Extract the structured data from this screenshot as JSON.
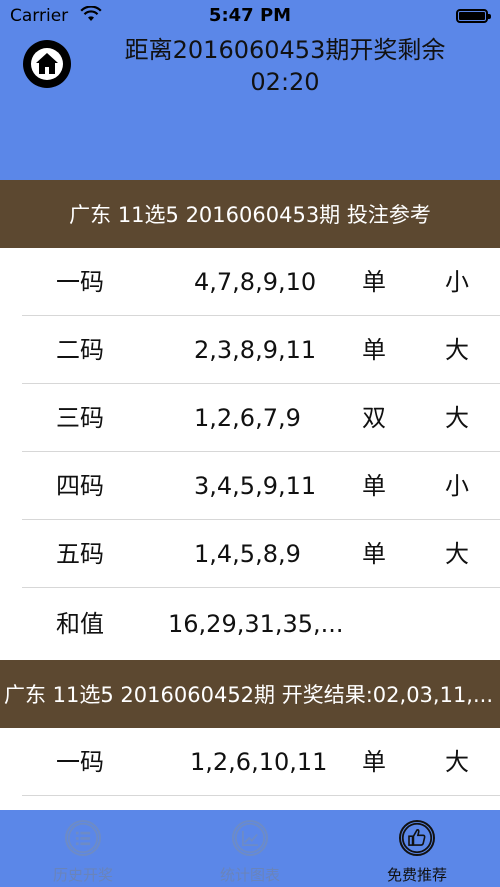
{
  "status_bar": {
    "carrier": "Carrier",
    "time": "5:47 PM"
  },
  "header": {
    "countdown_line1": "距离2016060453期开奖剩余",
    "countdown_line2": "02:20"
  },
  "section1": {
    "title": "广东 11选5 2016060453期 投注参考",
    "rows": [
      {
        "name": "一码",
        "nums": "4,7,8,9,10",
        "odd_even": "单",
        "big_small": "小"
      },
      {
        "name": "二码",
        "nums": "2,3,8,9,11",
        "odd_even": "单",
        "big_small": "大"
      },
      {
        "name": "三码",
        "nums": "1,2,6,7,9",
        "odd_even": "双",
        "big_small": "大"
      },
      {
        "name": "四码",
        "nums": "3,4,5,9,11",
        "odd_even": "单",
        "big_small": "小"
      },
      {
        "name": "五码",
        "nums": "1,4,5,8,9",
        "odd_even": "单",
        "big_small": "大"
      },
      {
        "name": "和值",
        "nums": "16,29,31,35,..."
      }
    ]
  },
  "section2": {
    "title": "广东 11选5 2016060452期 开奖结果:02,03,11,...",
    "rows": [
      {
        "name": "一码",
        "nums": "1,2,6,10,11",
        "odd_even": "单",
        "big_small": "大"
      }
    ]
  },
  "tabbar": {
    "tabs": [
      {
        "label": "历史开奖",
        "icon": "list-icon"
      },
      {
        "label": "统计图表",
        "icon": "chart-icon"
      },
      {
        "label": "免费推荐",
        "icon": "thumbs-up-icon"
      }
    ],
    "active_index": 2
  }
}
